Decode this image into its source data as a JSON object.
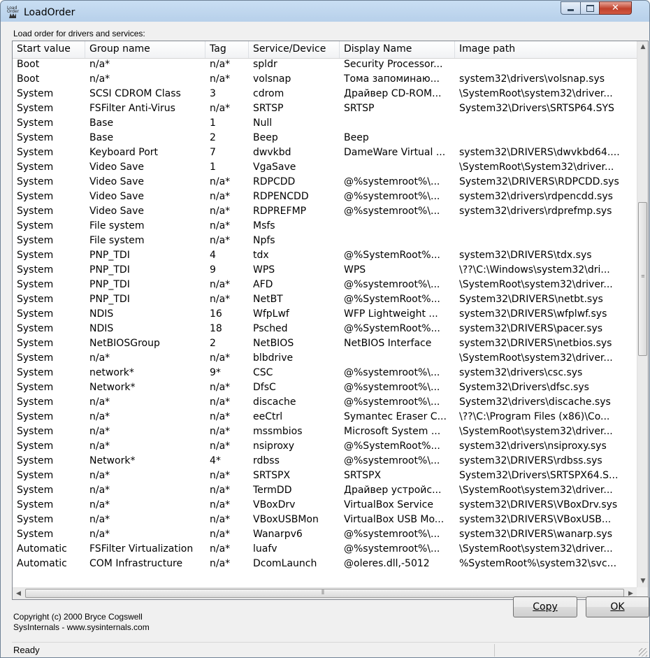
{
  "window": {
    "title": "LoadOrder",
    "icon_text": "Load Order"
  },
  "section_label": "Load order for drivers and services:",
  "columns": [
    "Start value",
    "Group name",
    "Tag",
    "Service/Device",
    "Display Name",
    "Image path"
  ],
  "rows": [
    [
      "Boot",
      "n/a*",
      "n/a*",
      "spldr",
      "Security Processor...",
      ""
    ],
    [
      "Boot",
      "n/a*",
      "n/a*",
      "volsnap",
      "Тома запоминаю...",
      "system32\\drivers\\volsnap.sys"
    ],
    [
      "System",
      "SCSI CDROM Class",
      "3",
      "cdrom",
      "Драйвер CD-ROM...",
      "\\SystemRoot\\system32\\driver..."
    ],
    [
      "System",
      "FSFilter Anti-Virus",
      "n/a*",
      "SRTSP",
      "SRTSP",
      "System32\\Drivers\\SRTSP64.SYS"
    ],
    [
      "System",
      "Base",
      "1",
      "Null",
      "",
      ""
    ],
    [
      "System",
      "Base",
      "2",
      "Beep",
      "Beep",
      ""
    ],
    [
      "System",
      "Keyboard Port",
      "7",
      "dwvkbd",
      "DameWare Virtual ...",
      "system32\\DRIVERS\\dwvkbd64...."
    ],
    [
      "System",
      "Video Save",
      "1",
      "VgaSave",
      "",
      "\\SystemRoot\\System32\\driver..."
    ],
    [
      "System",
      "Video Save",
      "n/a*",
      "RDPCDD",
      "@%systemroot%\\...",
      "System32\\DRIVERS\\RDPCDD.sys"
    ],
    [
      "System",
      "Video Save",
      "n/a*",
      "RDPENCDD",
      "@%systemroot%\\...",
      "system32\\drivers\\rdpencdd.sys"
    ],
    [
      "System",
      "Video Save",
      "n/a*",
      "RDPREFMP",
      "@%systemroot%\\...",
      "system32\\drivers\\rdprefmp.sys"
    ],
    [
      "System",
      "File system",
      "n/a*",
      "Msfs",
      "",
      ""
    ],
    [
      "System",
      "File system",
      "n/a*",
      "Npfs",
      "",
      ""
    ],
    [
      "System",
      "PNP_TDI",
      "4",
      "tdx",
      "@%SystemRoot%...",
      "system32\\DRIVERS\\tdx.sys"
    ],
    [
      "System",
      "PNP_TDI",
      "9",
      "WPS",
      "WPS",
      "\\??\\C:\\Windows\\system32\\dri..."
    ],
    [
      "System",
      "PNP_TDI",
      "n/a*",
      "AFD",
      "@%systemroot%\\...",
      "\\SystemRoot\\system32\\driver..."
    ],
    [
      "System",
      "PNP_TDI",
      "n/a*",
      "NetBT",
      "@%SystemRoot%...",
      "System32\\DRIVERS\\netbt.sys"
    ],
    [
      "System",
      "NDIS",
      "16",
      "WfpLwf",
      "WFP Lightweight ...",
      "system32\\DRIVERS\\wfplwf.sys"
    ],
    [
      "System",
      "NDIS",
      "18",
      "Psched",
      "@%SystemRoot%...",
      "system32\\DRIVERS\\pacer.sys"
    ],
    [
      "System",
      "NetBIOSGroup",
      "2",
      "NetBIOS",
      "NetBIOS Interface",
      "system32\\DRIVERS\\netbios.sys"
    ],
    [
      "System",
      "n/a*",
      "n/a*",
      "blbdrive",
      "",
      "\\SystemRoot\\system32\\driver..."
    ],
    [
      "System",
      "network*",
      "9*",
      "CSC",
      "@%systemroot%\\...",
      "system32\\drivers\\csc.sys"
    ],
    [
      "System",
      "Network*",
      "n/a*",
      "DfsC",
      "@%systemroot%\\...",
      "System32\\Drivers\\dfsc.sys"
    ],
    [
      "System",
      "n/a*",
      "n/a*",
      "discache",
      "@%systemroot%\\...",
      "System32\\drivers\\discache.sys"
    ],
    [
      "System",
      "n/a*",
      "n/a*",
      "eeCtrl",
      "Symantec Eraser C...",
      "\\??\\C:\\Program Files (x86)\\Co..."
    ],
    [
      "System",
      "n/a*",
      "n/a*",
      "mssmbios",
      "Microsoft System ...",
      "\\SystemRoot\\system32\\driver..."
    ],
    [
      "System",
      "n/a*",
      "n/a*",
      "nsiproxy",
      "@%SystemRoot%...",
      "system32\\drivers\\nsiproxy.sys"
    ],
    [
      "System",
      "Network*",
      "4*",
      "rdbss",
      "@%systemroot%\\...",
      "system32\\DRIVERS\\rdbss.sys"
    ],
    [
      "System",
      "n/a*",
      "n/a*",
      "SRTSPX",
      "SRTSPX",
      "System32\\Drivers\\SRTSPX64.S..."
    ],
    [
      "System",
      "n/a*",
      "n/a*",
      "TermDD",
      "Драйвер устройс...",
      "\\SystemRoot\\system32\\driver..."
    ],
    [
      "System",
      "n/a*",
      "n/a*",
      "VBoxDrv",
      "VirtualBox Service",
      "system32\\DRIVERS\\VBoxDrv.sys"
    ],
    [
      "System",
      "n/a*",
      "n/a*",
      "VBoxUSBMon",
      "VirtualBox USB Mo...",
      "system32\\DRIVERS\\VBoxUSB..."
    ],
    [
      "System",
      "n/a*",
      "n/a*",
      "Wanarpv6",
      "@%systemroot%\\...",
      "system32\\DRIVERS\\wanarp.sys"
    ],
    [
      "Automatic",
      "FSFilter Virtualization",
      "n/a*",
      "luafv",
      "@%systemroot%\\...",
      "\\SystemRoot\\system32\\driver..."
    ],
    [
      "Automatic",
      "COM Infrastructure",
      "n/a*",
      "DcomLaunch",
      "@oleres.dll,-5012",
      "%SystemRoot%\\system32\\svc..."
    ]
  ],
  "footer": {
    "copyright_line1": "Copyright (c) 2000 Bryce Cogswell",
    "copyright_line2": "SysInternals - www.sysinternals.com",
    "copy_label": "Copy",
    "ok_label": "OK"
  },
  "status": "Ready"
}
